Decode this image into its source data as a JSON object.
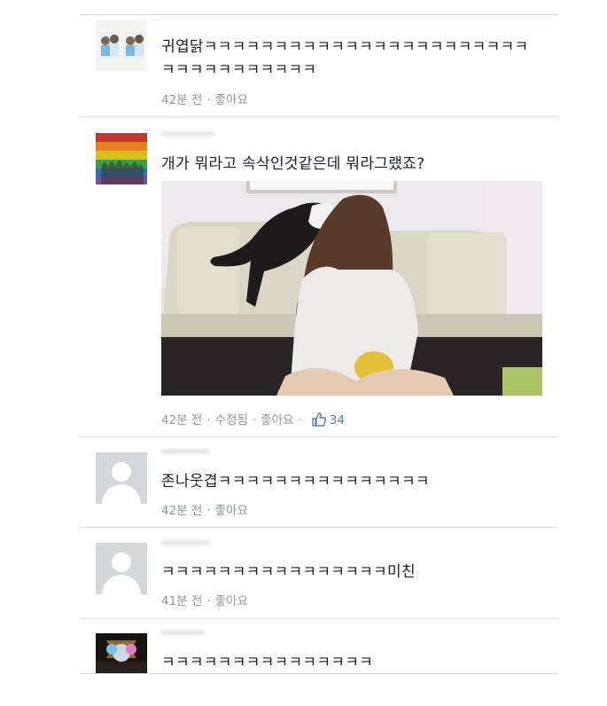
{
  "comments": [
    {
      "text": "귀엽닭ㅋㅋㅋㅋㅋㅋㅋㅋㅋㅋㅋㅋㅋㅋㅋㅋㅋㅋㅋㅋㅋㅋㅋㅋㅋㅋㅋㅋㅋㅋㅋㅋㅋㅋ",
      "time": "42분 전",
      "like": "좋아요"
    },
    {
      "text": "개가 뭐라고 속삭인것같은데 뭐라그랬죠?",
      "time": "42분 전",
      "edited": "수정됨",
      "like": "좋아요",
      "like_count": "34"
    },
    {
      "text": "존나웃겹ㅋㅋㅋㅋㅋㅋㅋㅋㅋㅋㅋㅋㅋㅋㅋ",
      "time": "42분 전",
      "like": "좋아요"
    },
    {
      "text": "ㅋㅋㅋㅋㅋㅋㅋㅋㅋㅋㅋㅋㅋㅋㅋㅋ미친",
      "time": "41분 전",
      "like": "좋아요"
    },
    {
      "text": "ㅋㅋㅋㅋㅋㅋㅋㅋㅋㅋㅋㅋㅋㅋㅋ"
    }
  ],
  "icons": {
    "like": "thumbs-up-icon",
    "default_avatar": "default-profile-icon"
  },
  "colors": {
    "meta_text": "#9197a3",
    "like_count": "#5b7bb3",
    "body_text": "#1d2129"
  }
}
